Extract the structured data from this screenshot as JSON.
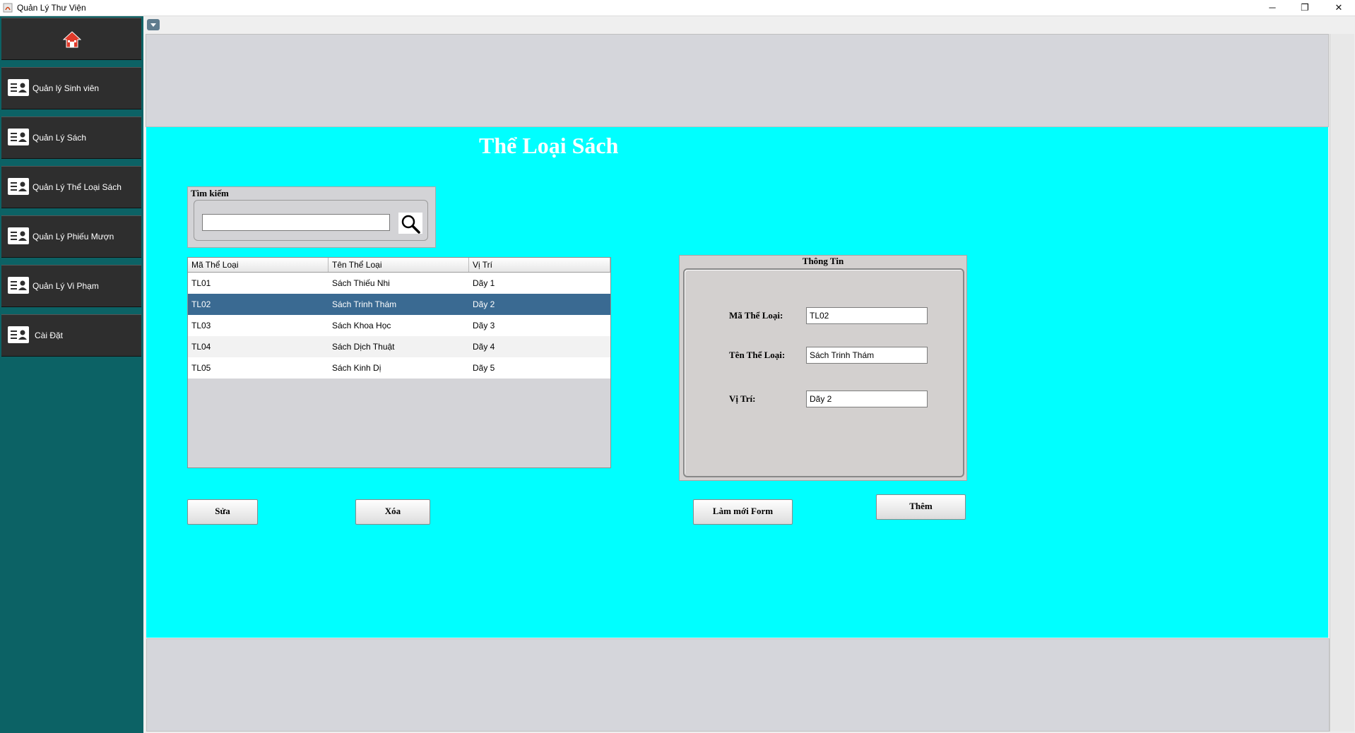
{
  "window": {
    "title": "Quản Lý Thư Viện",
    "minimize_glyph": "─",
    "maximize_glyph": "❐",
    "close_glyph": "✕"
  },
  "sidebar": {
    "items": [
      {
        "label": "Quản lý Sinh viên"
      },
      {
        "label": "Quản Lý Sách"
      },
      {
        "label": "Quản Lý Thể Loại Sách"
      },
      {
        "label": "Quản Lý Phiếu Mượn"
      },
      {
        "label": "Quản Lý Vi Phạm"
      },
      {
        "label": "Cài Đặt"
      }
    ]
  },
  "page": {
    "title": "Thể Loại Sách"
  },
  "search": {
    "label": "Tìm kiếm",
    "value": ""
  },
  "table": {
    "headers": [
      "Mã Thể Loại",
      "Tên Thể Loại",
      "Vị Trí"
    ],
    "rows": [
      [
        "TL01",
        "Sách Thiếu Nhi",
        "Dãy 1"
      ],
      [
        "TL02",
        "Sách Trinh Thám",
        "Dãy 2"
      ],
      [
        "TL03",
        "Sách Khoa Học",
        "Dãy 3"
      ],
      [
        "TL04",
        "Sách Dịch Thuật",
        "Dãy 4"
      ],
      [
        "TL05",
        "Sách Kinh Dị",
        "Dãy 5"
      ]
    ],
    "selected_row": 1
  },
  "info": {
    "title": "Thông Tin",
    "ma_label": "Mã Thể Loại:",
    "ma_value": "TL02",
    "ten_label": "Tên Thể Loại:",
    "ten_value": "Sách Trinh Thám",
    "vitri_label": "Vị Trí:",
    "vitri_value": "Dãy 2"
  },
  "buttons": {
    "edit": "Sửa",
    "delete": "Xóa",
    "reset": "Làm mới Form",
    "add": "Thêm"
  },
  "icons": {
    "home": "home-icon",
    "menu": "user-card-icon",
    "search": "magnifier-icon"
  },
  "colors": {
    "panel_cyan": "#00ffff",
    "sidebar_teal": "#0c6265",
    "sidebar_tile": "#2e2e2e",
    "selected_row": "#3a6a92",
    "home_red": "#e03a2a"
  }
}
